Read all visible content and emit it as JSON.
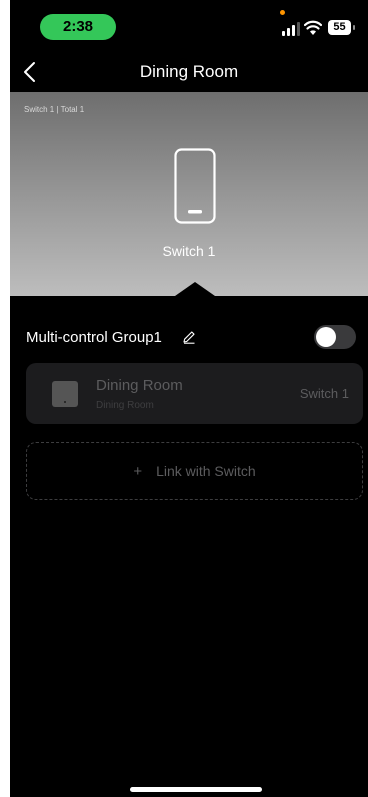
{
  "status_bar": {
    "time": "2:38",
    "battery": "55",
    "icons": [
      "signal-icon",
      "wifi-icon",
      "battery-icon"
    ]
  },
  "nav": {
    "title": "Dining Room",
    "back_icon": "chevron-left-icon"
  },
  "hero": {
    "caption": "Switch 1 | Total 1",
    "device_label": "Switch 1",
    "icon": "switch-device-icon"
  },
  "group": {
    "title": "Multi-control Group1",
    "edit_icon": "edit-icon",
    "toggle_on": false
  },
  "devices": [
    {
      "name": "Dining Room",
      "room": "Dining Room",
      "switch_label": "Switch 1"
    }
  ],
  "link_button": {
    "label": "Link with Switch",
    "icon": "plus-icon"
  },
  "colors": {
    "time_pill": "#34c759",
    "privacy_dot": "#ff9500",
    "background": "#000000",
    "card": "#1c1c1e"
  }
}
